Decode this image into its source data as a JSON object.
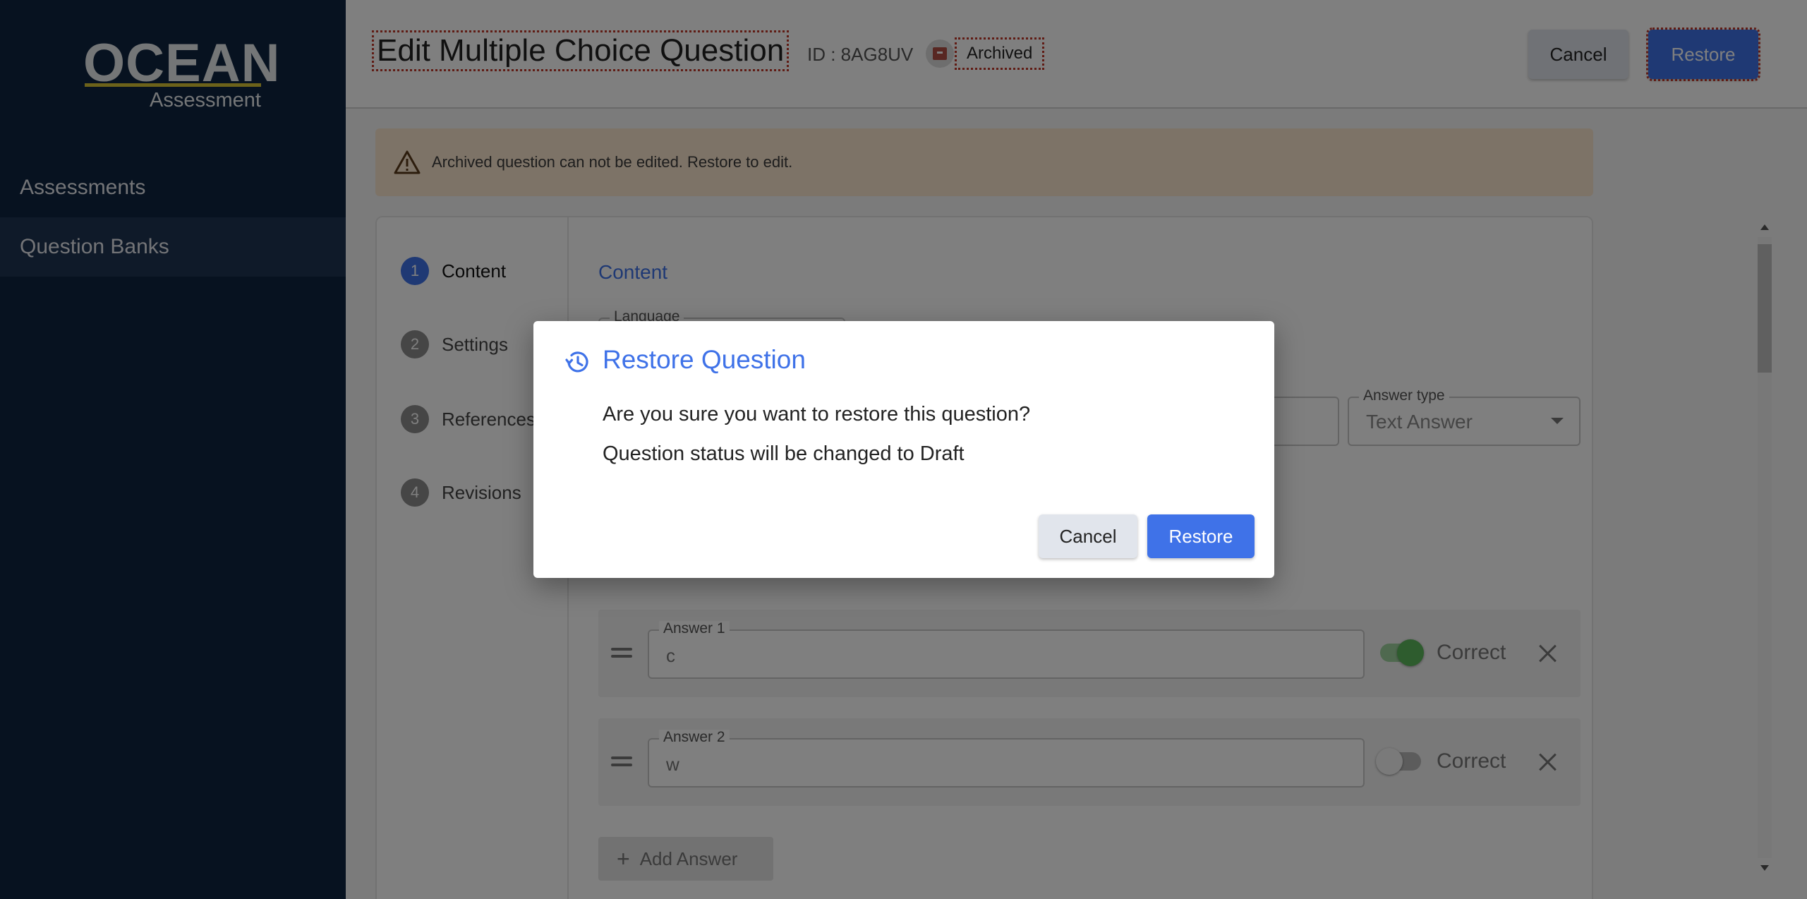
{
  "logo": {
    "brand": "OCEAN",
    "product": "Assessment"
  },
  "sidebar": {
    "items": [
      {
        "label": "Assessments",
        "active": false
      },
      {
        "label": "Question Banks",
        "active": true
      }
    ]
  },
  "header": {
    "title": "Edit Multiple Choice Question",
    "id_text": "ID : 8AG8UV",
    "status_badge": "Archived",
    "cancel_label": "Cancel",
    "restore_label": "Restore"
  },
  "warning": {
    "text": "Archived question can not be edited. Restore to edit."
  },
  "steps": [
    {
      "num": "1",
      "label": "Content",
      "active": true
    },
    {
      "num": "2",
      "label": "Settings",
      "active": false
    },
    {
      "num": "3",
      "label": "References",
      "active": false
    },
    {
      "num": "4",
      "label": "Revisions",
      "active": false
    }
  ],
  "content": {
    "title": "Content",
    "language_label": "Language",
    "answer_type": {
      "label": "Answer type",
      "value": "Text Answer"
    },
    "answers": [
      {
        "label": "Answer 1",
        "value": "c",
        "correct": true
      },
      {
        "label": "Answer 2",
        "value": "w",
        "correct": false
      }
    ],
    "correct_label": "Correct",
    "add_answer_label": "Add Answer"
  },
  "dialog": {
    "title": "Restore Question",
    "line1": "Are you sure you want to restore this question?",
    "line2": "Question status will be changed to Draft",
    "cancel_label": "Cancel",
    "restore_label": "Restore"
  },
  "colors": {
    "sidebar_bg": "#0f2440",
    "accent": "#3f72e8",
    "logo_underline": "#d8c534",
    "warning_bg": "#fbe6cf",
    "archived_icon": "#b14e45",
    "toggle_on": "#5cb85c"
  },
  "icons": {
    "warning": "warning-triangle-icon",
    "restore": "history-restore-icon",
    "archive": "archive-box-icon",
    "drag": "drag-handle-icon",
    "remove": "close-icon",
    "add": "plus-icon"
  }
}
